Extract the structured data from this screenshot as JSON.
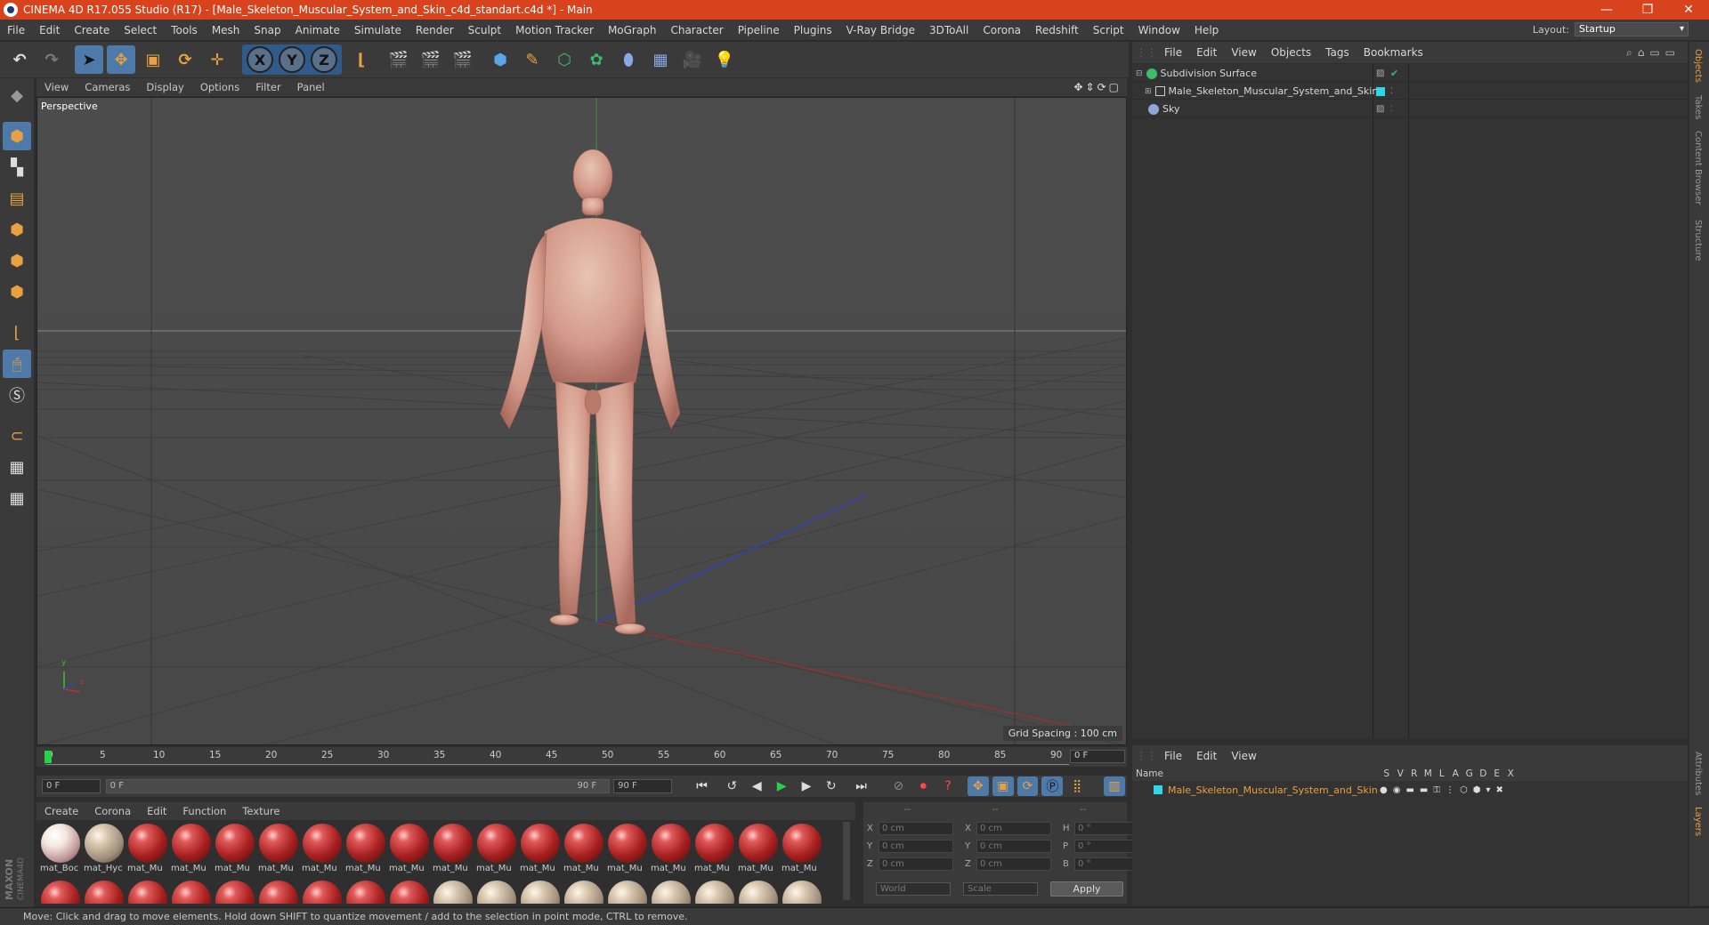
{
  "window": {
    "title": "CINEMA 4D R17.055 Studio (R17) - [Male_Skeleton_Muscular_System_and_Skin_c4d_standart.c4d *] - Main",
    "controls": [
      "—",
      "❐",
      "✕"
    ]
  },
  "menu": [
    "File",
    "Edit",
    "Create",
    "Select",
    "Tools",
    "Mesh",
    "Snap",
    "Animate",
    "Simulate",
    "Render",
    "Sculpt",
    "Motion Tracker",
    "MoGraph",
    "Character",
    "Pipeline",
    "Plugins",
    "V-Ray Bridge",
    "3DToAll",
    "Corona",
    "Redshift",
    "Script",
    "Window",
    "Help"
  ],
  "layout": {
    "label": "Layout:",
    "value": "Startup"
  },
  "toolbar": {
    "axis_x": "X",
    "axis_y": "Y",
    "axis_z": "Z"
  },
  "viewport": {
    "menu": [
      "View",
      "Cameras",
      "Display",
      "Options",
      "Filter",
      "Panel"
    ],
    "label": "Perspective",
    "grid_spacing": "Grid Spacing : 100 cm",
    "axis_y": "y",
    "axis_z": "z"
  },
  "timeline": {
    "ticks": [
      "0",
      "5",
      "10",
      "15",
      "20",
      "25",
      "30",
      "35",
      "40",
      "45",
      "50",
      "55",
      "60",
      "65",
      "70",
      "75",
      "80",
      "85",
      "90"
    ],
    "current_frame": "0 F",
    "start_frame": "0 F",
    "range_start": "0 F",
    "range_end": "90 F",
    "end_frame": "90 F"
  },
  "materials": {
    "menu": [
      "Create",
      "Corona",
      "Edit",
      "Function",
      "Texture"
    ],
    "row1": [
      {
        "name": "mat_Boc",
        "kind": "white"
      },
      {
        "name": "mat_Hyc",
        "kind": "tan"
      },
      {
        "name": "mat_Mu",
        "kind": "red"
      },
      {
        "name": "mat_Mu",
        "kind": "red"
      },
      {
        "name": "mat_Mu",
        "kind": "red"
      },
      {
        "name": "mat_Mu",
        "kind": "red"
      },
      {
        "name": "mat_Mu",
        "kind": "red"
      },
      {
        "name": "mat_Mu",
        "kind": "red"
      },
      {
        "name": "mat_Mu",
        "kind": "red"
      },
      {
        "name": "mat_Mu",
        "kind": "red"
      },
      {
        "name": "mat_Mu",
        "kind": "red"
      },
      {
        "name": "mat_Mu",
        "kind": "red"
      },
      {
        "name": "mat_Mu",
        "kind": "red"
      },
      {
        "name": "mat_Mu",
        "kind": "red"
      },
      {
        "name": "mat_Mu",
        "kind": "red"
      },
      {
        "name": "mat_Mu",
        "kind": "red"
      },
      {
        "name": "mat_Mu",
        "kind": "red"
      },
      {
        "name": "mat_Mu",
        "kind": "red"
      }
    ],
    "row2": [
      "red",
      "red",
      "red",
      "red",
      "red",
      "red",
      "red",
      "red",
      "red",
      "tan",
      "tan",
      "tan",
      "tan",
      "tan",
      "tan",
      "tan",
      "tan",
      "tan"
    ]
  },
  "coords": {
    "headers": [
      "--",
      "--",
      "--"
    ],
    "rows": [
      {
        "a": "X",
        "av": "0 cm",
        "b": "X",
        "bv": "0 cm",
        "c": "H",
        "cv": "0 °"
      },
      {
        "a": "Y",
        "av": "0 cm",
        "b": "Y",
        "bv": "0 cm",
        "c": "P",
        "cv": "0 °"
      },
      {
        "a": "Z",
        "av": "0 cm",
        "b": "Z",
        "bv": "0 cm",
        "c": "B",
        "cv": "0 °"
      }
    ],
    "space": "World",
    "mode": "Scale",
    "apply": "Apply"
  },
  "object_manager": {
    "menu": [
      "File",
      "Edit",
      "View",
      "Objects",
      "Tags",
      "Bookmarks"
    ],
    "objects": [
      {
        "name": "Subdivision Surface",
        "indent": 0,
        "icon_color": "#3dbb6a"
      },
      {
        "name": "Male_Skeleton_Muscular_System_and_Skin",
        "indent": 1,
        "icon_color": "#c8c8c8"
      },
      {
        "name": "Sky",
        "indent": 0,
        "icon_color": "#8aa8d8"
      }
    ]
  },
  "layer_manager": {
    "menu": [
      "File",
      "Edit",
      "View"
    ],
    "name_header": "Name",
    "columns": [
      "S",
      "V",
      "R",
      "M",
      "L",
      "A",
      "G",
      "D",
      "E",
      "X"
    ],
    "layer": {
      "name": "Male_Skeleton_Muscular_System_and_Skin",
      "color": "#2fd5e8"
    }
  },
  "right_tabs": [
    "Objects",
    "Takes",
    "Content Browser",
    "Structure",
    "Attributes",
    "Layers"
  ],
  "status": "Move: Click and drag to move elements. Hold down SHIFT to quantize movement / add to the selection in point mode, CTRL to remove.",
  "colors": {
    "title_bar": "#d8421c",
    "accent_orange": "#e8a040",
    "selected_blue": "#4d7aa8",
    "layer_name": "#e8a040"
  }
}
